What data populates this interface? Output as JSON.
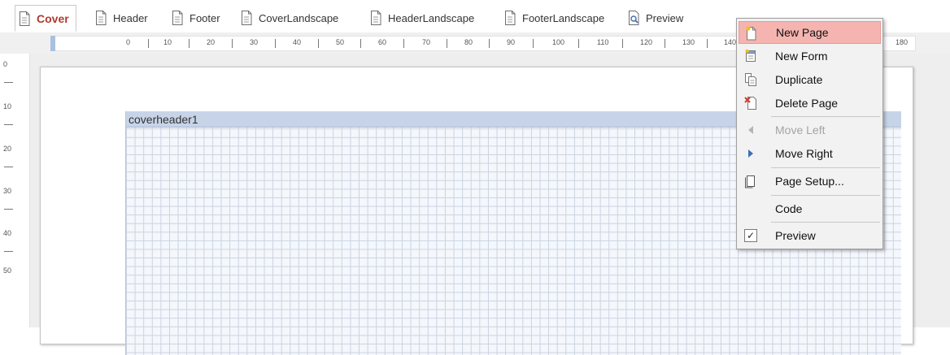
{
  "tabs": [
    {
      "label": "Cover",
      "active": true
    },
    {
      "label": "Header"
    },
    {
      "label": "Footer"
    },
    {
      "label": "CoverLandscape"
    },
    {
      "label": "HeaderLandscape"
    },
    {
      "label": "FooterLandscape"
    },
    {
      "label": "Preview",
      "icon": "preview-icon"
    }
  ],
  "ruler": {
    "horizontal": [
      "0",
      "10",
      "20",
      "30",
      "40",
      "50",
      "60",
      "70",
      "80",
      "90",
      "100",
      "110",
      "120",
      "130",
      "140",
      "180"
    ],
    "vertical": [
      "0",
      "10",
      "20",
      "30",
      "40",
      "50"
    ]
  },
  "band": {
    "name": "coverheader1"
  },
  "menu": {
    "items": [
      {
        "label": "New Page",
        "icon": "new-page-icon",
        "highlighted": true
      },
      {
        "label": "New Form",
        "icon": "new-form-icon"
      },
      {
        "label": "Duplicate",
        "icon": "duplicate-icon"
      },
      {
        "label": "Delete Page",
        "icon": "delete-page-icon"
      },
      {
        "label": "Move Left",
        "icon": "arrow-left-icon",
        "disabled": true
      },
      {
        "label": "Move Right",
        "icon": "arrow-right-icon"
      },
      {
        "label": "Page Setup...",
        "icon": "page-setup-icon"
      },
      {
        "label": "Code"
      },
      {
        "label": "Preview",
        "checked": true,
        "icon": "checkbox-checked-icon"
      }
    ],
    "check_mark": "✓"
  },
  "colors": {
    "active_tab_text": "#b03a2e",
    "menu_highlight": "#f5b4b0",
    "band_header": "#c7d4e8"
  }
}
